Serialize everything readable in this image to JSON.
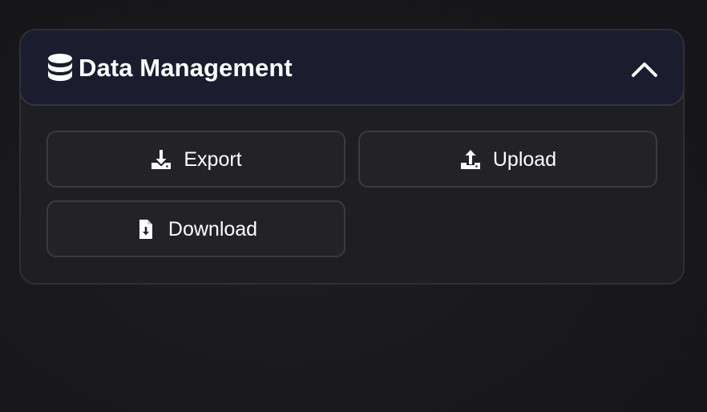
{
  "panel": {
    "title": "Data Management",
    "title_icon": "database-icon",
    "toggle_icon": "chevron-up-icon",
    "expanded": true
  },
  "buttons": {
    "export": {
      "label": "Export",
      "icon": "download-tray-icon"
    },
    "upload": {
      "label": "Upload",
      "icon": "upload-tray-icon"
    },
    "download": {
      "label": "Download",
      "icon": "file-download-icon"
    }
  },
  "colors": {
    "background": "#19191d",
    "panel_body": "#1f1f23",
    "panel_header": "#1b1c2d",
    "button_bg": "#232327",
    "button_border": "#3a3a41",
    "text": "#ffffff"
  }
}
